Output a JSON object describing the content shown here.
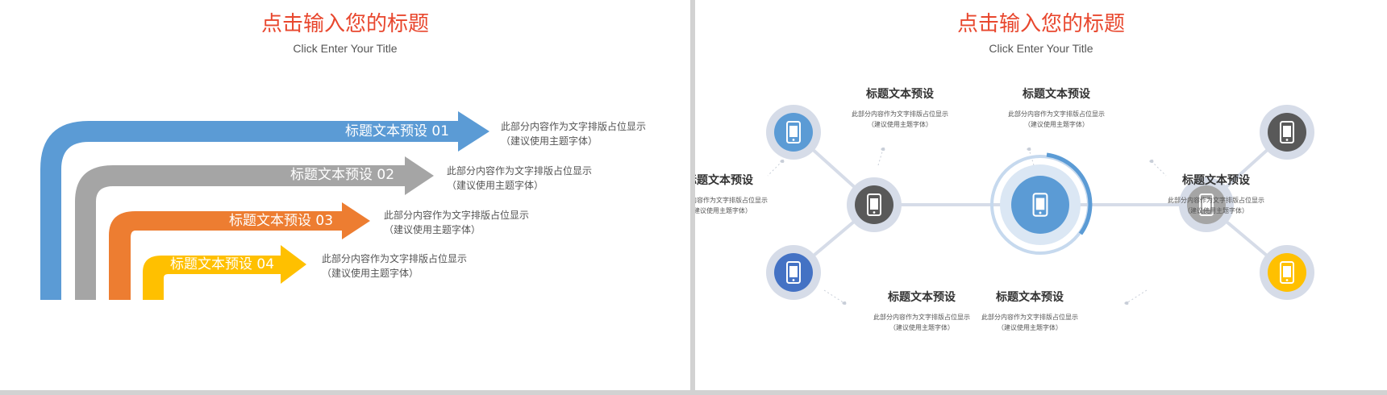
{
  "left_slide": {
    "title": "点击输入您的标题",
    "subtitle": "Click Enter Your Title",
    "arrows": [
      {
        "label": "标题文本预设 01",
        "color": "#5b9bd5",
        "desc_line1": "此部分内容作为文字排版占位显示",
        "desc_line2": "（建议使用主题字体）"
      },
      {
        "label": "标题文本预设 02",
        "color": "#a5a5a5",
        "desc_line1": "此部分内容作为文字排版占位显示",
        "desc_line2": "（建议使用主题字体）"
      },
      {
        "label": "标题文本预设 03",
        "color": "#ed7d31",
        "desc_line1": "此部分内容作为文字排版占位显示",
        "desc_line2": "（建议使用主题字体）"
      },
      {
        "label": "标题文本预设 04",
        "color": "#ffc000",
        "desc_line1": "此部分内容作为文字排版占位显示",
        "desc_line2": "（建议使用主题字体）"
      }
    ]
  },
  "right_slide": {
    "title": "点击输入您的标题",
    "subtitle": "Click Enter Your Title",
    "center_icon": "phone-icon",
    "nodes": [
      {
        "title": "标题文本预设",
        "desc_line1": "此部分内容作为文字排版占位显示",
        "desc_line2": "（建议使用主题字体）",
        "color": "#5b9bd5"
      },
      {
        "title": "标题文本预设",
        "desc_line1": "此部分内容作为文字排版占位显示",
        "desc_line2": "（建议使用主题字体）",
        "color": "#595959"
      },
      {
        "title": "标题文本预设",
        "desc_line1": "此部分内容作为文字排版占位显示",
        "desc_line2": "（建议使用主题字体）",
        "color": "#595959"
      },
      {
        "title": "标题文本预设",
        "desc_line1": "此部分内容作为文字排版占位显示",
        "desc_line2": "（建议使用主题字体）",
        "color": "#4472c4"
      },
      {
        "title": "标题文本预设",
        "desc_line1": "此部分内容作为文字排版占位显示",
        "desc_line2": "（建议使用主题字体）",
        "color": "#ffc000"
      },
      {
        "title": "标题文本预设",
        "desc_line1": "此部分内容作为文字排版占位显示",
        "desc_line2": "（建议使用主题字体）",
        "color": "#a5a5a5"
      }
    ]
  }
}
